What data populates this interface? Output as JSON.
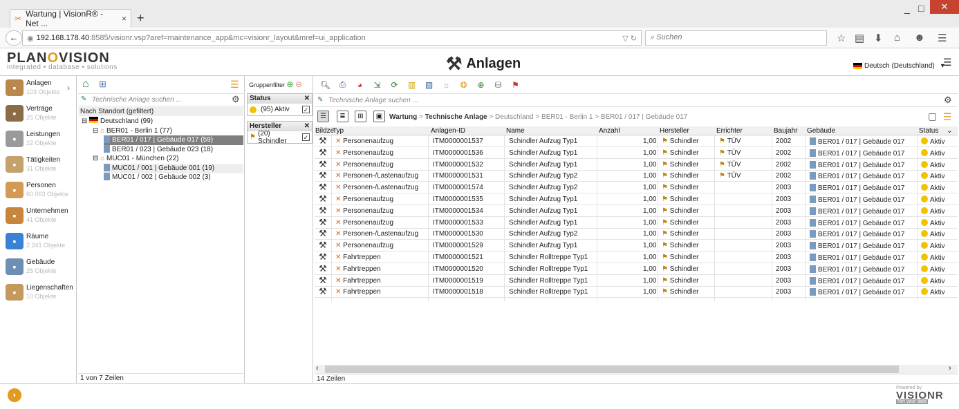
{
  "browser": {
    "tab_title": "Wartung | VisionR® - Net ...",
    "tab_close": "×",
    "new_tab": "+",
    "url_host": "192.168.178.40",
    "url_rest": ":8585/visionr.vsp?aref=maintenance_app&mc=visionr_layout&mref=ui_application",
    "search_placeholder": "Suchen",
    "window_controls": [
      "_",
      "□",
      "✕"
    ]
  },
  "app": {
    "logo": "PLANOVISION",
    "logo_tagline": "integrated • database • solutions",
    "page_title": "Anlagen",
    "language": "Deutsch (Deutschland)"
  },
  "leftnav": [
    {
      "label": "Anlagen",
      "count": "103 Objekte",
      "icon": "tools-icon",
      "color": "#b8884c"
    },
    {
      "label": "Verträge",
      "count": "25 Objekte",
      "icon": "contract-icon",
      "color": "#8a6d46"
    },
    {
      "label": "Leistungen",
      "count": "22 Objekte",
      "icon": "service-icon",
      "color": "#9a9a9a"
    },
    {
      "label": "Tätigkeiten",
      "count": "31 Objekte",
      "icon": "activity-icon",
      "color": "#c3a26c"
    },
    {
      "label": "Personen",
      "count": "60.063 Objekte",
      "icon": "person-icon",
      "color": "#d29a55"
    },
    {
      "label": "Unternehmen",
      "count": "41 Objekte",
      "icon": "company-icon",
      "color": "#c8863c"
    },
    {
      "label": "Räume",
      "count": "2.241 Objekte",
      "icon": "room-icon",
      "color": "#3b82d6"
    },
    {
      "label": "Gebäude",
      "count": "25 Objekte",
      "icon": "building-icon",
      "color": "#6e8fb3"
    },
    {
      "label": "Liegenschaften",
      "count": "10 Objekte",
      "icon": "property-icon",
      "color": "#c39a5c"
    }
  ],
  "tree": {
    "search_placeholder": "Technische Anlage suchen ...",
    "header": "Nach Standort (gefiltert)",
    "nodes": [
      {
        "label": "Deutschland (99)",
        "level": 0,
        "state": ""
      },
      {
        "label": "BER01 - Berlin 1 (77)",
        "level": 1,
        "state": ""
      },
      {
        "label": "BER01 / 017 | Gebäude 017 (59)",
        "level": 2,
        "state": "sel"
      },
      {
        "label": "BER01 / 023 | Gebäude 023 (18)",
        "level": 2,
        "state": ""
      },
      {
        "label": "MUC01 - München (22)",
        "level": 1,
        "state": ""
      },
      {
        "label": "MUC01 / 001 | Gebäude 001 (19)",
        "level": 2,
        "state": "alt"
      },
      {
        "label": "MUC01 / 002 | Gebäude 002 (3)",
        "level": 2,
        "state": ""
      }
    ],
    "footer": "1 von 7 Zeilen"
  },
  "filter": {
    "title": "Gruppenfilter",
    "groups": [
      {
        "title": "Status",
        "value": "(95) Aktiv",
        "checked": true
      },
      {
        "title": "Hersteller",
        "value": "(20) Schindler",
        "checked": true
      }
    ]
  },
  "main": {
    "search_placeholder": "Technische Anlage suchen ...",
    "breadcrumb_bold": [
      "Wartung",
      "Technische Anlage"
    ],
    "breadcrumb_rest": "Deutschland > BER01 - Berlin 1 > BER01 / 017 | Gebäude 017",
    "columns": [
      "Bildze",
      "Typ",
      "Anlagen-ID",
      "Name",
      "Anzahl",
      "Hersteller",
      "Errichter",
      "Baujahr",
      "Gebäude",
      "Status"
    ],
    "rows": [
      {
        "typ": "Personenaufzug",
        "id": "ITM0000001537",
        "name": "Schindler Aufzug Typ1",
        "anzahl": "1,00",
        "hersteller": "Schindler",
        "errichter": "TÜV",
        "baujahr": "2002",
        "gebaeude": "BER01 / 017 | Gebäude 017",
        "status": "Aktiv"
      },
      {
        "typ": "Personenaufzug",
        "id": "ITM0000001536",
        "name": "Schindler Aufzug Typ1",
        "anzahl": "1,00",
        "hersteller": "Schindler",
        "errichter": "TÜV",
        "baujahr": "2002",
        "gebaeude": "BER01 / 017 | Gebäude 017",
        "status": "Aktiv"
      },
      {
        "typ": "Personenaufzug",
        "id": "ITM0000001532",
        "name": "Schindler Aufzug Typ1",
        "anzahl": "1,00",
        "hersteller": "Schindler",
        "errichter": "TÜV",
        "baujahr": "2002",
        "gebaeude": "BER01 / 017 | Gebäude 017",
        "status": "Aktiv"
      },
      {
        "typ": "Personen-/Lastenaufzug",
        "id": "ITM0000001531",
        "name": "Schindler Aufzug Typ2",
        "anzahl": "1,00",
        "hersteller": "Schindler",
        "errichter": "TÜV",
        "baujahr": "2002",
        "gebaeude": "BER01 / 017 | Gebäude 017",
        "status": "Aktiv"
      },
      {
        "typ": "Personen-/Lastenaufzug",
        "id": "ITM0000001574",
        "name": "Schindler Aufzug Typ2",
        "anzahl": "1,00",
        "hersteller": "Schindler",
        "errichter": "",
        "baujahr": "2003",
        "gebaeude": "BER01 / 017 | Gebäude 017",
        "status": "Aktiv"
      },
      {
        "typ": "Personenaufzug",
        "id": "ITM0000001535",
        "name": "Schindler Aufzug Typ1",
        "anzahl": "1,00",
        "hersteller": "Schindler",
        "errichter": "",
        "baujahr": "2003",
        "gebaeude": "BER01 / 017 | Gebäude 017",
        "status": "Aktiv"
      },
      {
        "typ": "Personenaufzug",
        "id": "ITM0000001534",
        "name": "Schindler Aufzug Typ1",
        "anzahl": "1,00",
        "hersteller": "Schindler",
        "errichter": "",
        "baujahr": "2003",
        "gebaeude": "BER01 / 017 | Gebäude 017",
        "status": "Aktiv"
      },
      {
        "typ": "Personenaufzug",
        "id": "ITM0000001533",
        "name": "Schindler Aufzug Typ1",
        "anzahl": "1,00",
        "hersteller": "Schindler",
        "errichter": "",
        "baujahr": "2003",
        "gebaeude": "BER01 / 017 | Gebäude 017",
        "status": "Aktiv"
      },
      {
        "typ": "Personen-/Lastenaufzug",
        "id": "ITM0000001530",
        "name": "Schindler Aufzug Typ2",
        "anzahl": "1,00",
        "hersteller": "Schindler",
        "errichter": "",
        "baujahr": "2003",
        "gebaeude": "BER01 / 017 | Gebäude 017",
        "status": "Aktiv"
      },
      {
        "typ": "Personenaufzug",
        "id": "ITM0000001529",
        "name": "Schindler Aufzug Typ1",
        "anzahl": "1,00",
        "hersteller": "Schindler",
        "errichter": "",
        "baujahr": "2003",
        "gebaeude": "BER01 / 017 | Gebäude 017",
        "status": "Aktiv"
      },
      {
        "typ": "Fahrtreppen",
        "id": "ITM0000001521",
        "name": "Schindler Rolltreppe Typ1",
        "anzahl": "1,00",
        "hersteller": "Schindler",
        "errichter": "",
        "baujahr": "2003",
        "gebaeude": "BER01 / 017 | Gebäude 017",
        "status": "Aktiv"
      },
      {
        "typ": "Fahrtreppen",
        "id": "ITM0000001520",
        "name": "Schindler Rolltreppe Typ1",
        "anzahl": "1,00",
        "hersteller": "Schindler",
        "errichter": "",
        "baujahr": "2003",
        "gebaeude": "BER01 / 017 | Gebäude 017",
        "status": "Aktiv"
      },
      {
        "typ": "Fahrtreppen",
        "id": "ITM0000001519",
        "name": "Schindler Rolltreppe Typ1",
        "anzahl": "1,00",
        "hersteller": "Schindler",
        "errichter": "",
        "baujahr": "2003",
        "gebaeude": "BER01 / 017 | Gebäude 017",
        "status": "Aktiv"
      },
      {
        "typ": "Fahrtreppen",
        "id": "ITM0000001518",
        "name": "Schindler Rolltreppe Typ1",
        "anzahl": "1,00",
        "hersteller": "Schindler",
        "errichter": "",
        "baujahr": "2003",
        "gebaeude": "BER01 / 017 | Gebäude 017",
        "status": "Aktiv"
      }
    ],
    "footer": "14 Zeilen"
  },
  "footer": {
    "powered": "Powered by",
    "brand": "VISIONR",
    "slogan": "Net your data"
  }
}
